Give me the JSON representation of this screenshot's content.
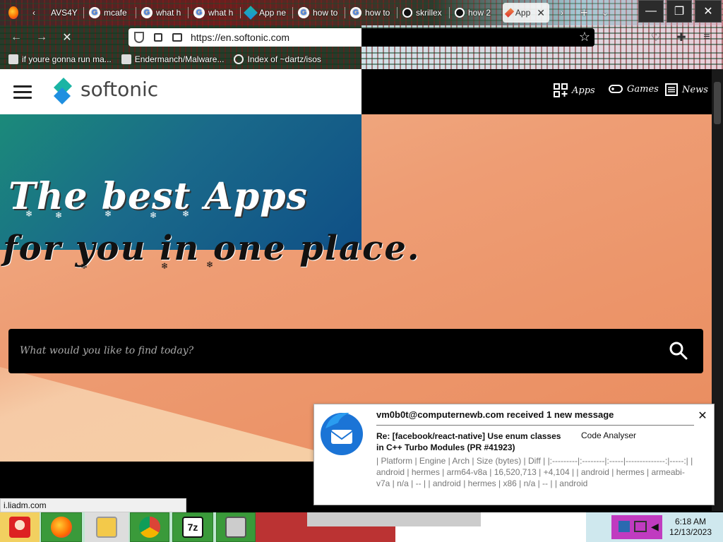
{
  "browser": {
    "tabs": [
      {
        "label": "",
        "icon": "firefox-icon"
      },
      {
        "label": "",
        "icon": "chevron-left-icon"
      },
      {
        "label": "AVS4Y",
        "icon": ""
      },
      {
        "label": "mcafe",
        "icon": "google-icon"
      },
      {
        "label": "what h",
        "icon": "google-icon"
      },
      {
        "label": "what h",
        "icon": "google-icon"
      },
      {
        "label": "App ne",
        "icon": "softonic-icon"
      },
      {
        "label": "how to",
        "icon": "google-icon"
      },
      {
        "label": "how to",
        "icon": "google-icon"
      },
      {
        "label": "skrillex",
        "icon": "github-icon"
      },
      {
        "label": "how 2",
        "icon": "github-icon"
      },
      {
        "label": "App",
        "icon": "softonic-icon"
      }
    ],
    "url": "https://en.softonic.com",
    "bookmarks": [
      "if youre gonna run ma...",
      "Endermanch/Malware...",
      "Index of ~dartz/isos"
    ],
    "status_url": "i.liadm.com"
  },
  "site": {
    "logo_text": "softonic",
    "nav": [
      {
        "label": "Apps",
        "icon": "apps-grid-icon"
      },
      {
        "label": "Games",
        "icon": "gamepad-icon"
      },
      {
        "label": "News",
        "icon": "news-icon"
      }
    ],
    "hero_title": "The best Apps",
    "hero_subtitle": "for you in one place.",
    "search_placeholder": "What would you like to find today?"
  },
  "notification": {
    "sender": "vm0b0t@computernewb.com received 1 new message",
    "subject": "Re: [facebook/react-native] Use enum classes in C++ Turbo Modules (PR #41923)",
    "folder": "Code Analyser",
    "body": "| Platform | Engine | Arch | Size (bytes) | Diff | |:---------|:--------|:-----|--------------:|-----:| | android | hermes | arm64-v8a | 16,520,713 | +4,104 | | android | hermes | armeabi-v7a | n/a | -- | | android | hermes | x86 | n/a | -- | | android"
  },
  "taskbar": {
    "apps": [
      "start-santa-icon",
      "firefox-icon",
      "file-explorer-icon",
      "chrome-icon",
      "7zip-icon",
      "task-manager-icon"
    ],
    "app_7zip_label": "7z",
    "time": "6:18 AM",
    "date": "12/13/2023"
  },
  "colors": {
    "accent_green": "#3a9a3a",
    "softonic_teal": "#1bb4a4",
    "softonic_blue": "#1f8fe0"
  }
}
